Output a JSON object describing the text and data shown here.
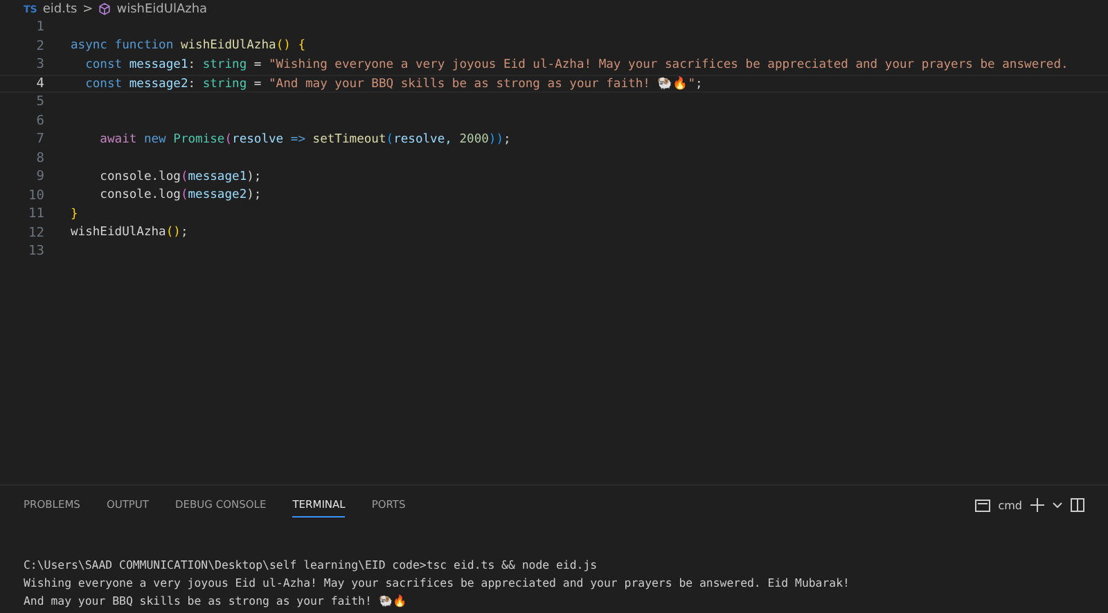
{
  "breadcrumb": {
    "file_badge": "TS",
    "file": "eid.ts",
    "separator": ">",
    "symbol": "wishEidUlAzha"
  },
  "editor": {
    "lines": [
      {
        "number": "1",
        "current": false
      },
      {
        "number": "2",
        "current": false,
        "tokens": [
          {
            "text": "async ",
            "kind": "keyword"
          },
          {
            "text": "function ",
            "kind": "keyword"
          },
          {
            "text": "wishEidUlAzha",
            "kind": "function"
          },
          {
            "text": "() {",
            "kind": "bracket"
          }
        ]
      },
      {
        "number": "3",
        "current": false,
        "tokens": [
          {
            "text": "  const ",
            "kind": "keyword"
          },
          {
            "text": "message1",
            "kind": "variable"
          },
          {
            "text": ": ",
            "kind": "plain"
          },
          {
            "text": "string",
            "kind": "type"
          },
          {
            "text": " = ",
            "kind": "plain"
          },
          {
            "text": "\"Wishing everyone a very joyous Eid ul-Azha! May your sacrifices be appreciated and your prayers be answered.",
            "kind": "string"
          }
        ]
      },
      {
        "number": "4",
        "current": true,
        "tokens": [
          {
            "text": "  const ",
            "kind": "keyword"
          },
          {
            "text": "message2",
            "kind": "variable"
          },
          {
            "text": ": ",
            "kind": "plain"
          },
          {
            "text": "string",
            "kind": "type"
          },
          {
            "text": " = ",
            "kind": "plain"
          },
          {
            "text": "\"And may your BBQ skills be as strong as your faith! 🐏🔥\"",
            "kind": "string"
          },
          {
            "text": ";",
            "kind": "plain"
          }
        ]
      },
      {
        "number": "5",
        "current": false
      },
      {
        "number": "6",
        "current": false
      },
      {
        "number": "7",
        "current": false,
        "tokens": [
          {
            "text": "    await ",
            "kind": "control"
          },
          {
            "text": "new ",
            "kind": "keyword"
          },
          {
            "text": "Promise",
            "kind": "type"
          },
          {
            "text": "(",
            "kind": "bracket2"
          },
          {
            "text": "resolve ",
            "kind": "variable"
          },
          {
            "text": "=> ",
            "kind": "keyword"
          },
          {
            "text": "setTimeout",
            "kind": "function"
          },
          {
            "text": "(",
            "kind": "bracket3"
          },
          {
            "text": "resolve, ",
            "kind": "variable"
          },
          {
            "text": "2000",
            "kind": "number"
          },
          {
            "text": "))",
            "kind": "bracket3"
          },
          {
            "text": ";",
            "kind": "plain"
          }
        ]
      },
      {
        "number": "8",
        "current": false
      },
      {
        "number": "9",
        "current": false,
        "tokens": [
          {
            "text": "    console.log",
            "kind": "plain"
          },
          {
            "text": "(",
            "kind": "bracket2"
          },
          {
            "text": "message1",
            "kind": "variable"
          },
          {
            "text": ");",
            "kind": "plain"
          }
        ]
      },
      {
        "number": "10",
        "current": false,
        "tokens": [
          {
            "text": "    console.log",
            "kind": "plain"
          },
          {
            "text": "(",
            "kind": "bracket2"
          },
          {
            "text": "message2",
            "kind": "variable"
          },
          {
            "text": ");",
            "kind": "plain"
          }
        ]
      },
      {
        "number": "11",
        "current": false,
        "tokens": [
          {
            "text": "}",
            "kind": "bracket"
          }
        ]
      },
      {
        "number": "12",
        "current": false,
        "tokens": [
          {
            "text": "wishEidUlAzha",
            "kind": "plain"
          },
          {
            "text": "()",
            "kind": "bracket"
          },
          {
            "text": ";",
            "kind": "plain"
          }
        ]
      },
      {
        "number": "13",
        "current": false
      }
    ]
  },
  "panel": {
    "tabs": [
      {
        "label": "PROBLEMS",
        "selected": false
      },
      {
        "label": "OUTPUT",
        "selected": false
      },
      {
        "label": "DEBUG CONSOLE",
        "selected": false
      },
      {
        "label": "TERMINAL",
        "selected": true
      },
      {
        "label": "PORTS",
        "selected": false
      }
    ],
    "shell": "cmd",
    "terminal_lines": [
      "C:\\Users\\SAAD COMMUNICATION\\Desktop\\self learning\\EID code>tsc eid.ts && node eid.js",
      "Wishing everyone a very joyous Eid ul-Azha! May your sacrifices be appreciated and your prayers be answered. Eid Mubarak!",
      "And may your BBQ skills be as strong as your faith! 🐏🔥"
    ]
  }
}
